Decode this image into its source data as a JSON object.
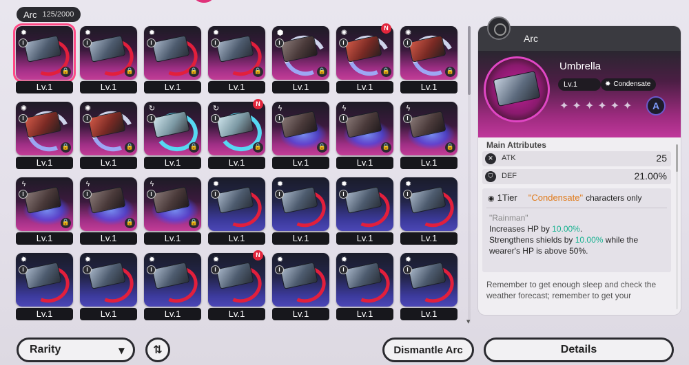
{
  "header": {
    "title": "Arc",
    "count": "125/2000"
  },
  "grid": {
    "cards": [
      {
        "level": "Lv.1",
        "style": "pink",
        "ring": "red",
        "art": "steel",
        "icon": "gear",
        "lock": true,
        "new": false,
        "selected": true
      },
      {
        "level": "Lv.1",
        "style": "pink",
        "ring": "red",
        "art": "steel",
        "icon": "gear",
        "lock": true,
        "new": false
      },
      {
        "level": "Lv.1",
        "style": "pink",
        "ring": "red",
        "art": "steel",
        "icon": "gear",
        "lock": true,
        "new": false
      },
      {
        "level": "Lv.1",
        "style": "pink",
        "ring": "red",
        "art": "steel",
        "icon": "gear",
        "lock": true,
        "new": false
      },
      {
        "level": "Lv.1",
        "style": "pink",
        "ring": "wave",
        "art": "dark",
        "icon": "cube",
        "lock": true,
        "new": false
      },
      {
        "level": "Lv.1",
        "style": "pink",
        "ring": "wave",
        "art": "red",
        "icon": "swirl",
        "lock": true,
        "new": true
      },
      {
        "level": "Lv.1",
        "style": "pink",
        "ring": "wave",
        "art": "red",
        "icon": "swirl",
        "lock": true,
        "new": false
      },
      {
        "level": "Lv.1",
        "style": "pink",
        "ring": "wave",
        "art": "red",
        "icon": "swirl",
        "lock": true,
        "new": false
      },
      {
        "level": "Lv.1",
        "style": "pink",
        "ring": "wave",
        "art": "red",
        "icon": "swirl",
        "lock": true,
        "new": false
      },
      {
        "level": "Lv.1",
        "style": "pink",
        "ring": "cyan",
        "art": "cyan",
        "icon": "cycle",
        "lock": true,
        "new": false
      },
      {
        "level": "Lv.1",
        "style": "pink",
        "ring": "cyan",
        "art": "cyan",
        "icon": "cycle",
        "lock": true,
        "new": true
      },
      {
        "level": "Lv.1",
        "style": "pink",
        "ring": "elec",
        "art": "dark",
        "icon": "bolt",
        "lock": true,
        "new": false
      },
      {
        "level": "Lv.1",
        "style": "pink",
        "ring": "elec",
        "art": "dark",
        "icon": "bolt",
        "lock": true,
        "new": false
      },
      {
        "level": "Lv.1",
        "style": "pink",
        "ring": "elec",
        "art": "dark",
        "icon": "bolt",
        "lock": true,
        "new": false
      },
      {
        "level": "Lv.1",
        "style": "pink",
        "ring": "elec",
        "art": "dark",
        "icon": "bolt",
        "lock": true,
        "new": false
      },
      {
        "level": "Lv.1",
        "style": "pink",
        "ring": "elec",
        "art": "dark",
        "icon": "bolt",
        "lock": true,
        "new": false
      },
      {
        "level": "Lv.1",
        "style": "pink",
        "ring": "elec",
        "art": "dark",
        "icon": "bolt",
        "lock": true,
        "new": false
      },
      {
        "level": "Lv.1",
        "style": "blue",
        "ring": "red",
        "art": "steel",
        "icon": "gear",
        "lock": false,
        "new": false
      },
      {
        "level": "Lv.1",
        "style": "blue",
        "ring": "red",
        "art": "steel",
        "icon": "gear",
        "lock": false,
        "new": false
      },
      {
        "level": "Lv.1",
        "style": "blue",
        "ring": "red",
        "art": "steel",
        "icon": "gear",
        "lock": false,
        "new": false
      },
      {
        "level": "Lv.1",
        "style": "blue",
        "ring": "red",
        "art": "steel",
        "icon": "gear",
        "lock": false,
        "new": false
      },
      {
        "level": "Lv.1",
        "style": "blue",
        "ring": "red",
        "art": "steel",
        "icon": "gear",
        "lock": false,
        "new": false
      },
      {
        "level": "Lv.1",
        "style": "blue",
        "ring": "red",
        "art": "steel",
        "icon": "gear",
        "lock": false,
        "new": false
      },
      {
        "level": "Lv.1",
        "style": "blue",
        "ring": "red",
        "art": "steel",
        "icon": "gear",
        "lock": false,
        "new": false
      },
      {
        "level": "Lv.1",
        "style": "blue",
        "ring": "red",
        "art": "steel",
        "icon": "gear",
        "lock": false,
        "new": true
      },
      {
        "level": "Lv.1",
        "style": "blue",
        "ring": "red",
        "art": "steel",
        "icon": "gear",
        "lock": false,
        "new": false
      },
      {
        "level": "Lv.1",
        "style": "blue",
        "ring": "red",
        "art": "steel",
        "icon": "gear",
        "lock": false,
        "new": false
      },
      {
        "level": "Lv.1",
        "style": "blue",
        "ring": "red",
        "art": "steel",
        "icon": "gear",
        "lock": false,
        "new": false
      }
    ],
    "tier_label": "I",
    "new_label": "N"
  },
  "detail": {
    "header": "Arc",
    "name": "Umbrella",
    "level": "Lv.1",
    "tag": "Condensate",
    "rank_label": "A",
    "section_title": "Main Attributes",
    "attributes": [
      {
        "name": "ATK",
        "value": "25"
      },
      {
        "name": "DEF",
        "value": "21.00%"
      }
    ],
    "effect": {
      "tier": "1Tier",
      "condition": "\"Condensate\"",
      "condition_rest": "characters only",
      "quote": "\"Rainman\"",
      "line1_pre": "Increases HP by ",
      "line1_hl": "10.00%",
      "line1_post": ".",
      "line2_pre": "Strengthens shields by ",
      "line2_hl": "10.00%",
      "line2_post": " while the",
      "line3": "wearer's HP is above 50%."
    },
    "flavor": "Remember to get enough sleep and check the weather forecast; remember to get your"
  },
  "buttons": {
    "rarity": "Rarity",
    "dismantle": "Dismantle Arc",
    "details": "Details"
  },
  "icons": {
    "gear": "✹",
    "cube": "⬢",
    "swirl": "✺",
    "cycle": "↻",
    "bolt": "ϟ",
    "lock": "🔒",
    "chevron": "▼",
    "sort": "⇅",
    "tier_dot": "◉"
  }
}
